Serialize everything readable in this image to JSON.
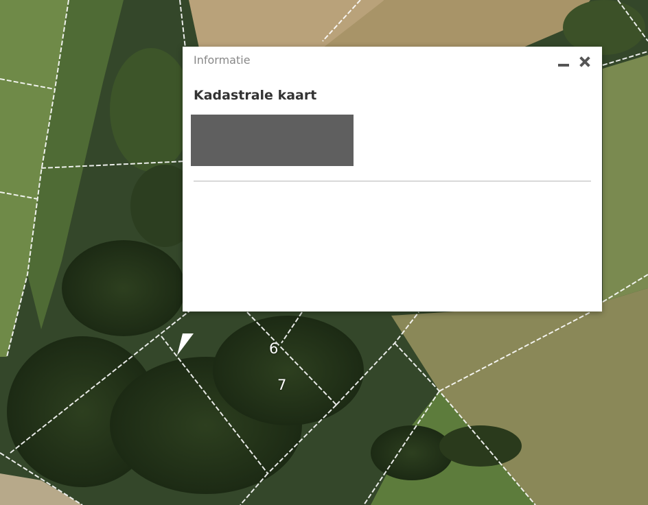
{
  "popup": {
    "title": "Informatie",
    "heading": "Kadastrale kaart",
    "minimize_label": "minimize",
    "close_label": "close"
  },
  "map": {
    "parcel_labels": [
      "6",
      "7"
    ]
  },
  "colors": {
    "popup_bg": "#ffffff",
    "redacted": "#5f5f5f",
    "parcel_line": "#ffffff"
  }
}
